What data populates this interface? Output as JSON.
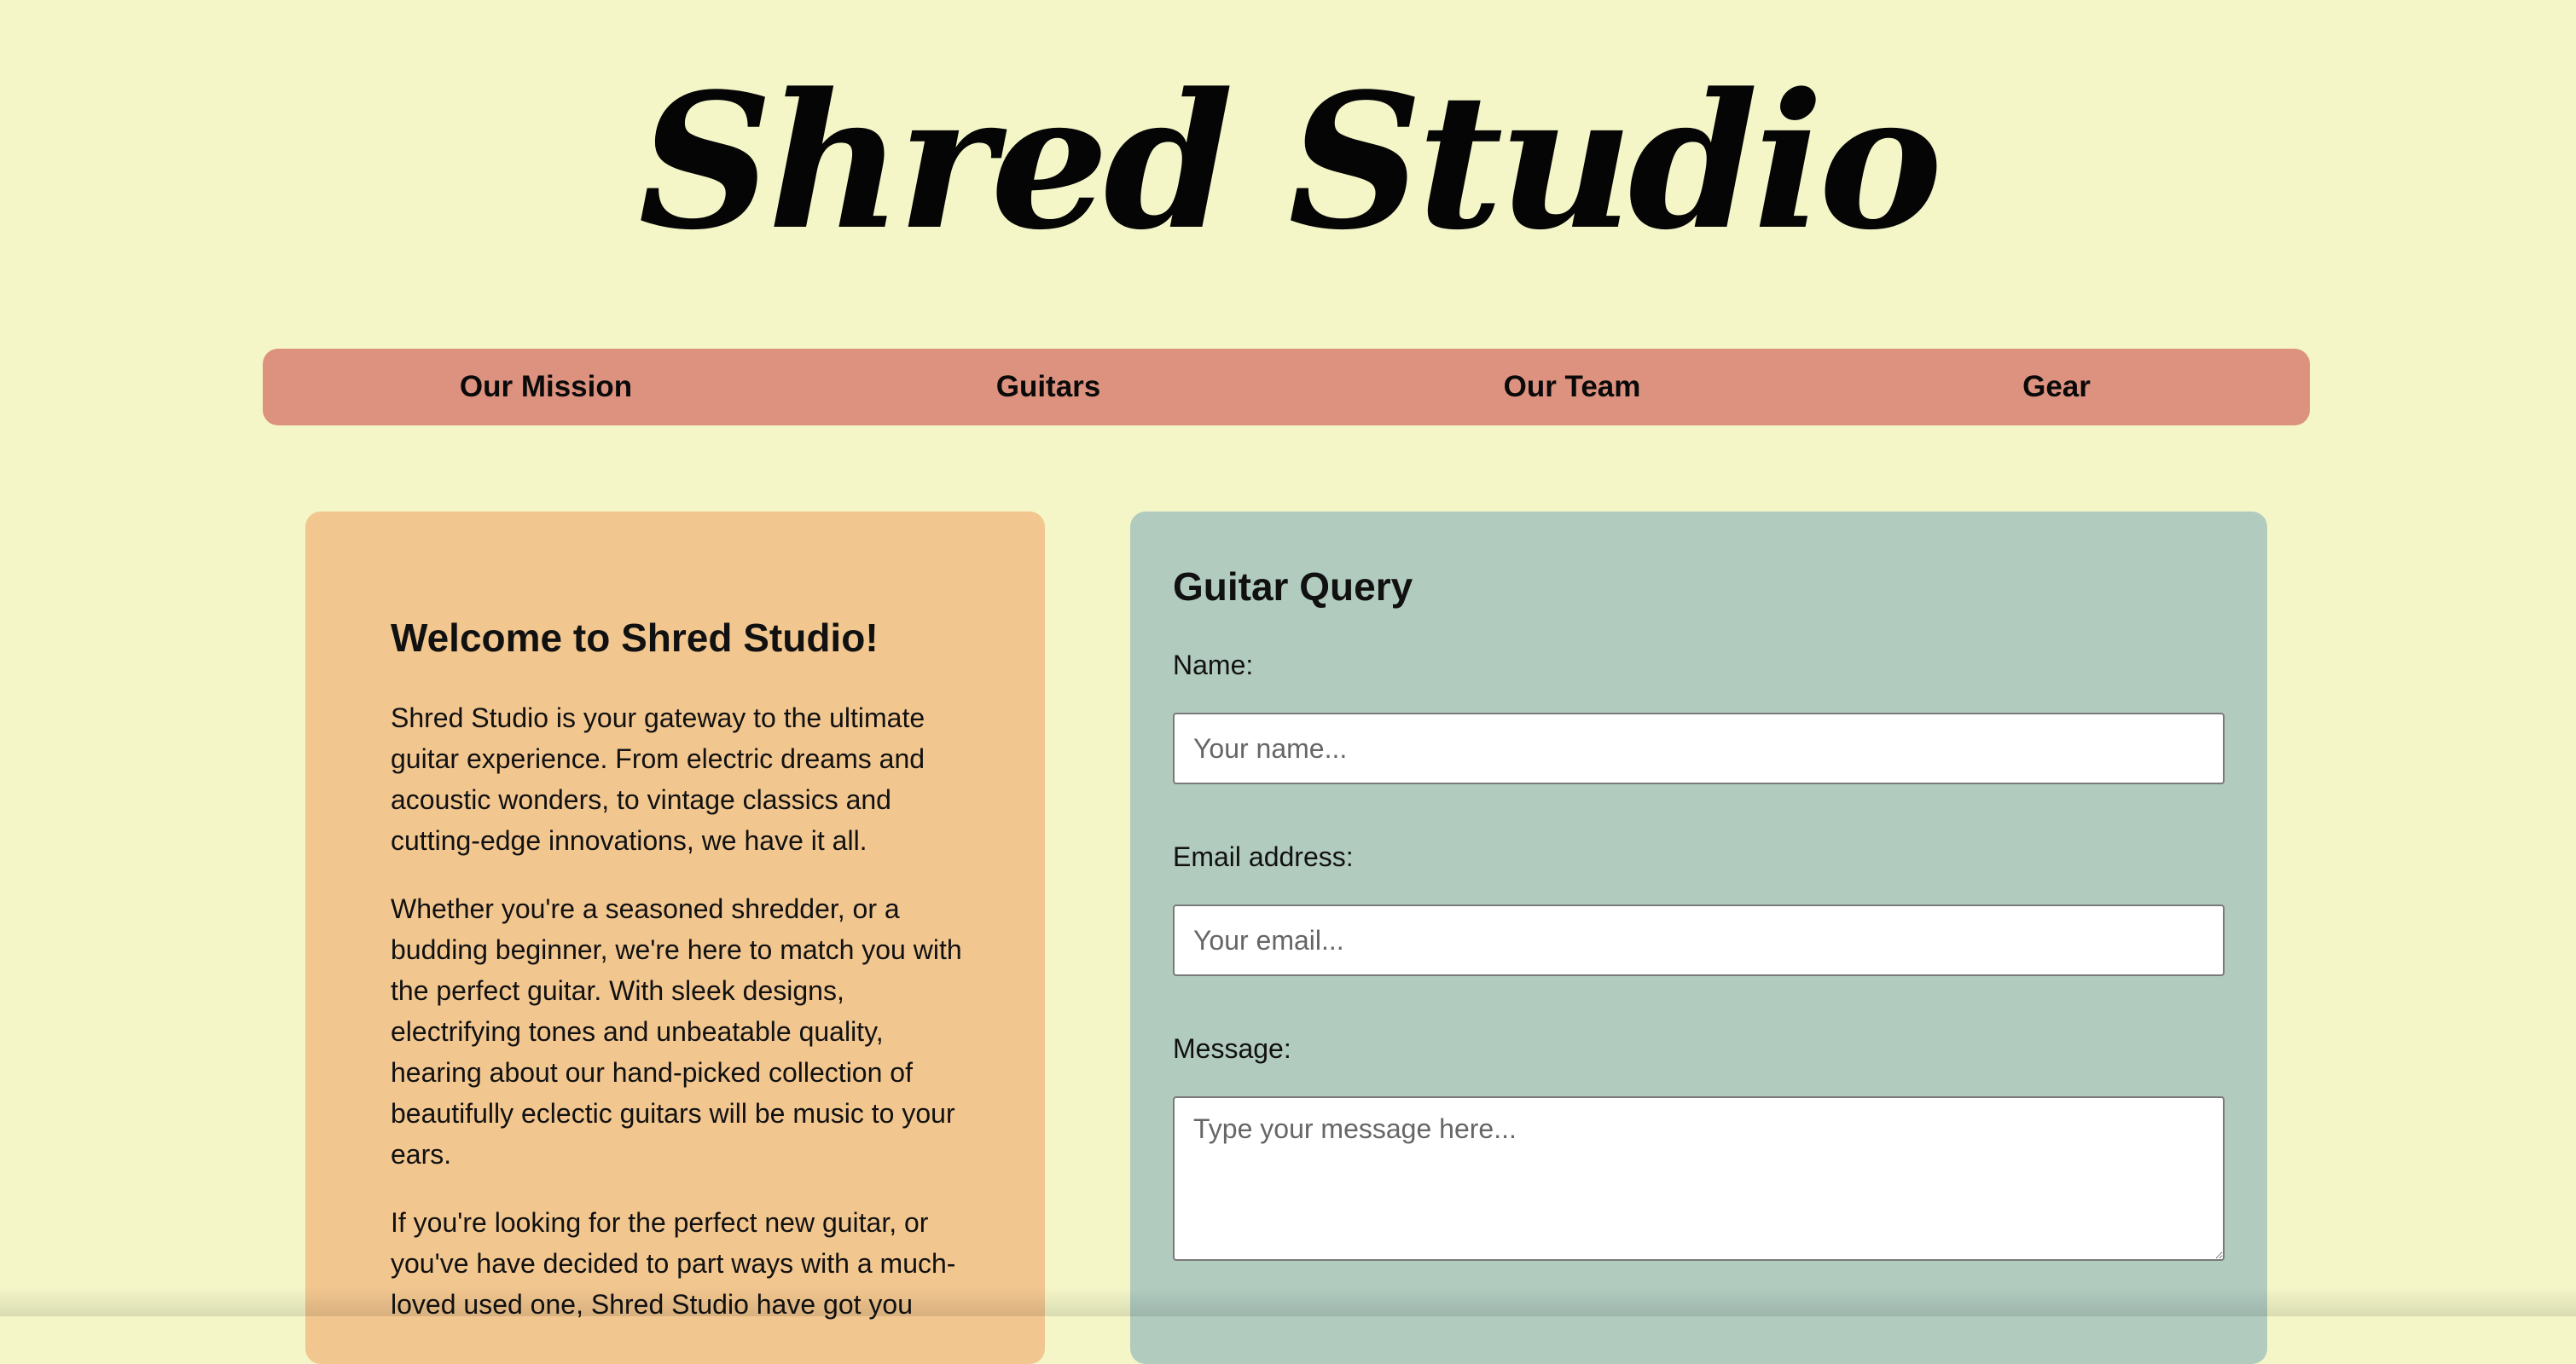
{
  "header": {
    "title": "Shred Studio"
  },
  "nav": {
    "items": [
      {
        "label": "Our Mission"
      },
      {
        "label": "Guitars"
      },
      {
        "label": "Our Team"
      },
      {
        "label": "Gear"
      }
    ]
  },
  "welcome": {
    "heading": "Welcome to Shred Studio!",
    "paragraphs": [
      "Shred Studio is your gateway to the ultimate guitar experience. From electric dreams and acoustic wonders, to vintage classics and cutting-edge innovations, we have it all.",
      "Whether you're a seasoned shredder, or a budding beginner, we're here to match you with the perfect guitar. With sleek designs, electrifying tones and unbeatable quality, hearing about our hand-picked collection of beautifully eclectic guitars will be music to your ears.",
      "If you're looking for the perfect new guitar, or you've have decided to part ways with a much-loved used one, Shred Studio have got you"
    ]
  },
  "form": {
    "title": "Guitar Query",
    "name_label": "Name:",
    "name_placeholder": "Your name...",
    "email_label": "Email address:",
    "email_placeholder": "Your email...",
    "message_label": "Message:",
    "message_placeholder": "Type your message here..."
  },
  "colors": {
    "page_background": "#f4f6c8",
    "nav_background": "#dd927f",
    "welcome_card": "#f2c68f",
    "form_card": "#b1cbbf"
  }
}
